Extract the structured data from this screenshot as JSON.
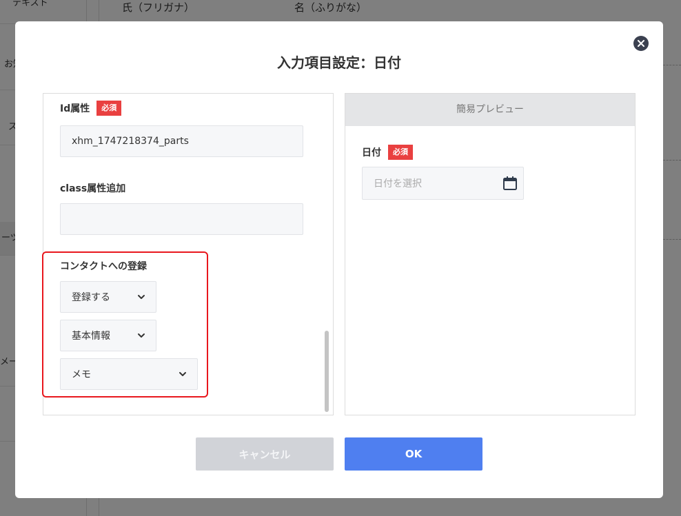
{
  "background": {
    "sidebar_items": [
      "テキスト",
      "お知",
      "ス",
      "ーツ",
      "メー"
    ],
    "field_labels": [
      "氏（フリガナ）",
      "名（ふりがな）"
    ]
  },
  "modal": {
    "title": "入力項目設定：日付",
    "close_icon": "close-circle-icon",
    "settings": {
      "id_label": "Id属性",
      "required_badge": "必須",
      "id_value": "xhm_1747218374_parts",
      "class_label": "class属性追加",
      "class_value": "",
      "contact_label": "コンタクトへの登録",
      "register_select": "登録する",
      "category_select": "基本情報",
      "field_select": "メモ"
    },
    "preview": {
      "header": "簡易プレビュー",
      "date_label": "日付",
      "required_badge": "必須",
      "date_placeholder": "日付を選択",
      "calendar_icon": "calendar-icon"
    },
    "buttons": {
      "cancel": "キャンセル",
      "ok": "OK"
    }
  },
  "colors": {
    "required_badge": "#e94040",
    "ok_button": "#4f7ff0",
    "cancel_button": "#d1d3d8",
    "highlight": "#e8161c"
  }
}
